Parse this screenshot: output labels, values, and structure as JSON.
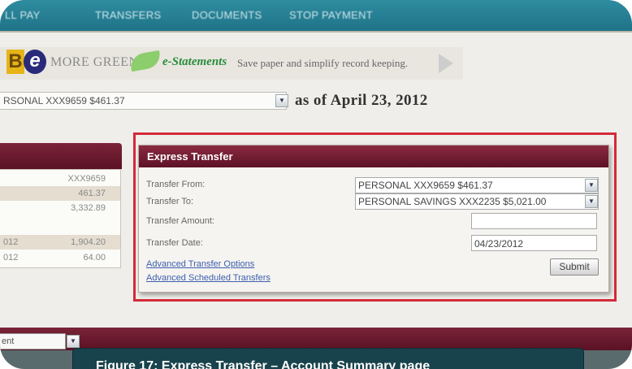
{
  "nav": {
    "items": [
      "LL PAY",
      "TRANSFERS",
      "DOCUMENTS",
      "STOP PAYMENT"
    ]
  },
  "promo": {
    "logo_b": "B",
    "logo_e": "e",
    "more_green": "MORE GREEN",
    "estatements": "e-Statements",
    "text": "Save paper and simplify record keeping."
  },
  "account_selector": {
    "value": "RSONAL XXX9659 $461.37",
    "as_of": "as of April 23, 2012"
  },
  "summary": {
    "rows": [
      {
        "left": "",
        "right": "XXX9659"
      },
      {
        "left": "",
        "right": "461.37"
      },
      {
        "left": "",
        "right": "3,332.89"
      },
      {
        "left": "012",
        "right": "1,904.20"
      },
      {
        "left": "012",
        "right": "64.00"
      }
    ]
  },
  "express_transfer": {
    "title": "Express Transfer",
    "labels": {
      "from": "Transfer From:",
      "to": "Transfer To:",
      "amount": "Transfer Amount:",
      "date": "Transfer Date:"
    },
    "from_value": "PERSONAL XXX9659 $461.37",
    "to_value": "PERSONAL SAVINGS XXX2235 $5,021.00",
    "amount_value": "",
    "date_value": "04/23/2012",
    "links": {
      "advanced_options": "Advanced Transfer Options",
      "advanced_scheduled": "Advanced Scheduled Transfers"
    },
    "submit_label": "Submit"
  },
  "bottom": {
    "select_value": "ent"
  },
  "caption": "Figure 17: Express Transfer – Account Summary page",
  "colors": {
    "nav": "#2f8ca0",
    "panel_header": "#6e1c30",
    "highlight": "#d42a3a",
    "link": "#3c5fb0"
  }
}
